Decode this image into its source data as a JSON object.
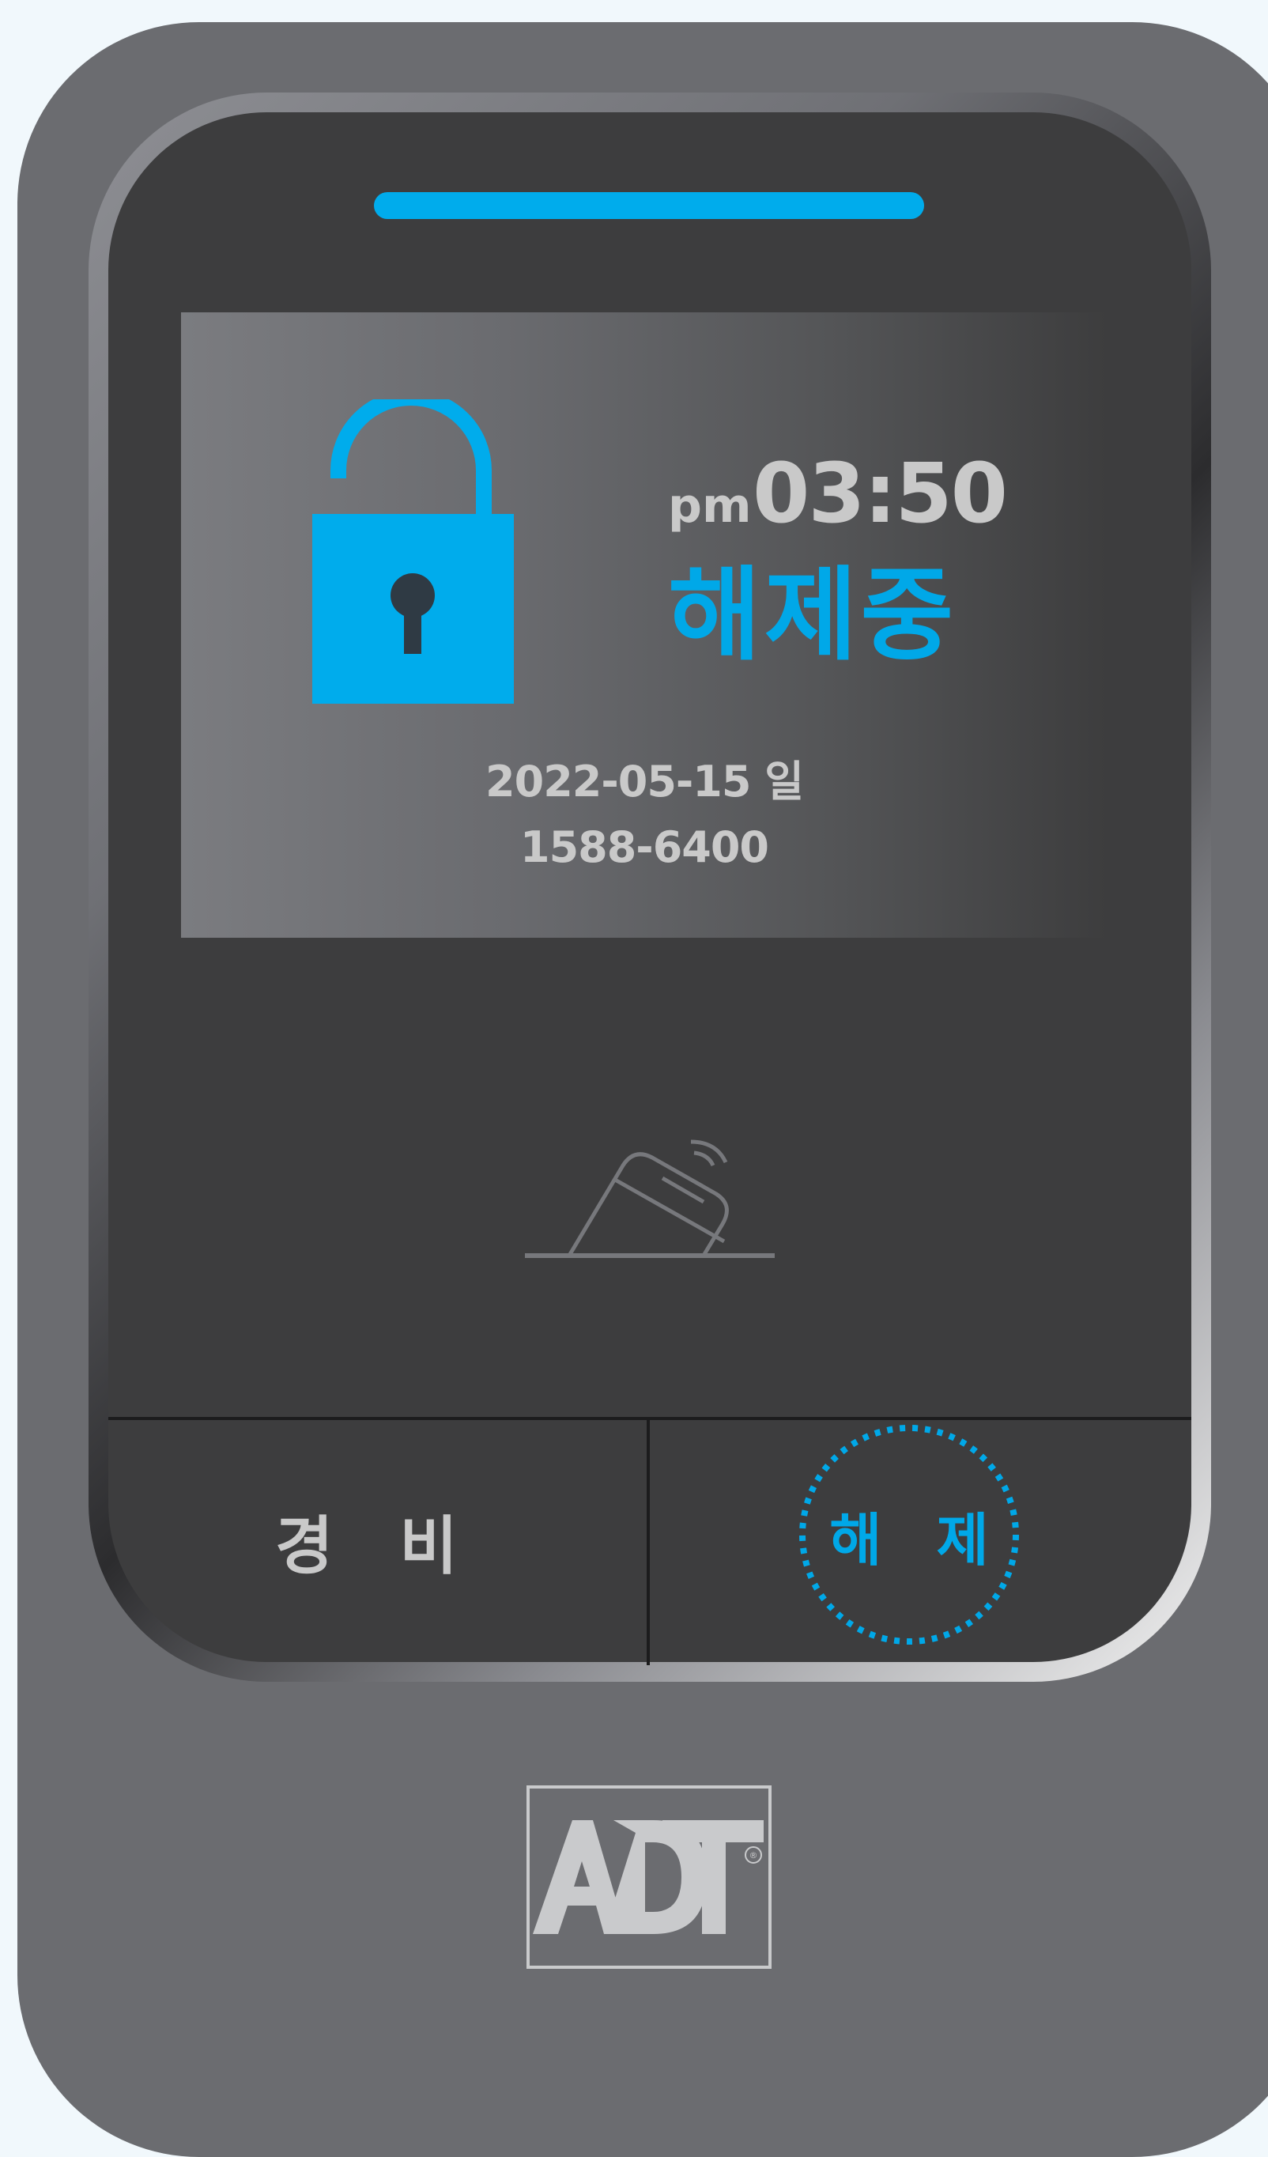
{
  "display": {
    "ampm": "pm",
    "time": "03:50",
    "status": "해제중",
    "date": "2022-05-15 일",
    "phone": "1588-6400"
  },
  "buttons": {
    "arm_label": "경 비",
    "disarm_label": "해 제"
  },
  "logo": {
    "text": "ADT",
    "registered_mark": "®"
  },
  "icons": {
    "lock": "unlocked-padlock-icon",
    "tag": "card-tag-icon"
  },
  "colors": {
    "accent": "#00acec",
    "device_body": "#6b6c70",
    "screen": "#3d3d3e",
    "text_gray": "#c9c9c9"
  }
}
